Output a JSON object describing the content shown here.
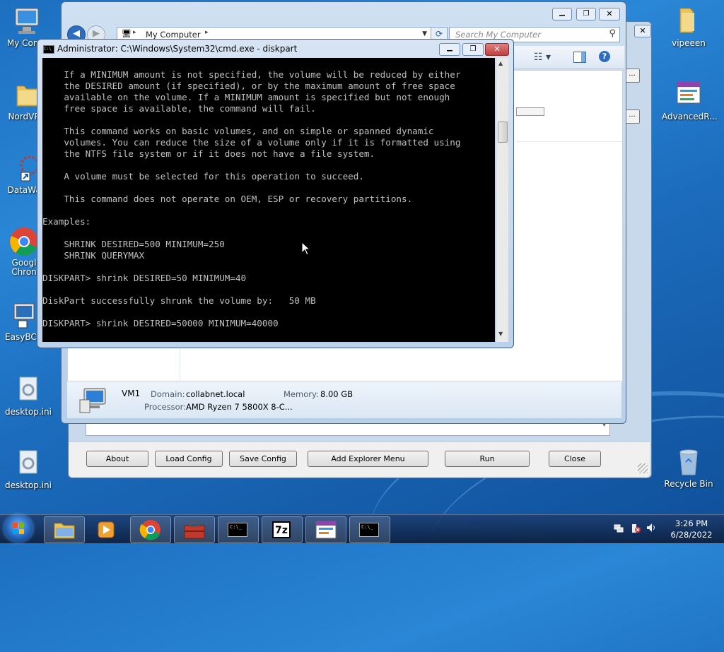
{
  "desktop": {
    "icons_left": [
      {
        "label": "My Comp",
        "icon": "computer-icon"
      },
      {
        "label": "NordVPN",
        "icon": "folder-icon"
      },
      {
        "label": "DataWag",
        "icon": "shortcut-icon"
      },
      {
        "label": "Googl Chron",
        "icon": "chrome-icon"
      },
      {
        "label": "EasyBCD",
        "icon": "easybcd-icon"
      },
      {
        "label": "desktop.ini",
        "icon": "settings-file-icon"
      },
      {
        "label": "desktop.ini",
        "icon": "settings-file-icon"
      }
    ],
    "icons_right": [
      {
        "label": "vipeeen",
        "icon": "folder-icon"
      },
      {
        "label": "AdvancedR...",
        "icon": "app-icon"
      },
      {
        "label": "Recycle Bin",
        "icon": "recycle-bin-icon"
      }
    ]
  },
  "explorer": {
    "address": "My Computer",
    "search_placeholder": "Search My Computer",
    "details": {
      "name": "VM1",
      "domain_label": "Domain:",
      "domain_value": "collabnet.local",
      "memory_label": "Memory:",
      "memory_value": "8.00 GB",
      "processor_label": "Processor:",
      "processor_value": "AMD Ryzen 7 5800X 8-C..."
    }
  },
  "tool_dialog": {
    "buttons": {
      "about": "About",
      "load_config": "Load Config",
      "save_config": "Save Config",
      "add_explorer_menu": "Add Explorer Menu",
      "run": "Run",
      "close": "Close"
    }
  },
  "cmd": {
    "title": "Administrator: C:\\Windows\\System32\\cmd.exe - diskpart",
    "icon_text": "C:\\",
    "lines": [
      "    If a MINIMUM amount is not specified, the volume will be reduced by either",
      "    the DESIRED amount (if specified), or by the maximum amount of free space",
      "    available on the volume. If a MINIMUM amount is specified but not enough",
      "    free space is available, the command will fail.",
      "",
      "    This command works on basic volumes, and on simple or spanned dynamic",
      "    volumes. You can reduce the size of a volume only if it is formatted using",
      "    the NTFS file system or if it does not have a file system.",
      "",
      "    A volume must be selected for this operation to succeed.",
      "",
      "    This command does not operate on OEM, ESP or recovery partitions.",
      "",
      "Examples:",
      "",
      "    SHRINK DESIRED=500 MINIMUM=250",
      "    SHRINK QUERYMAX",
      "",
      "DISKPART> shrink DESIRED=50 MINIMUM=40",
      "",
      "DiskPart successfully shrunk the volume by:   50 MB",
      "",
      "DISKPART> shrink DESIRED=50000 MINIMUM=40000"
    ]
  },
  "taskbar": {
    "time": "3:26 PM",
    "date": "6/28/2022",
    "items": [
      "explorer-icon",
      "media-player-icon",
      "chrome-icon",
      "toolbox-icon",
      "cmd-icon",
      "7zip-icon",
      "app-icon",
      "cmd-icon"
    ],
    "sevenzip_label": "7z",
    "cmd_label": "C:\\_"
  },
  "colors": {
    "desktop": "#1f6fc0",
    "cmd_bg": "#000000",
    "cmd_text": "#c0c0c0",
    "close_red": "#c75050"
  }
}
